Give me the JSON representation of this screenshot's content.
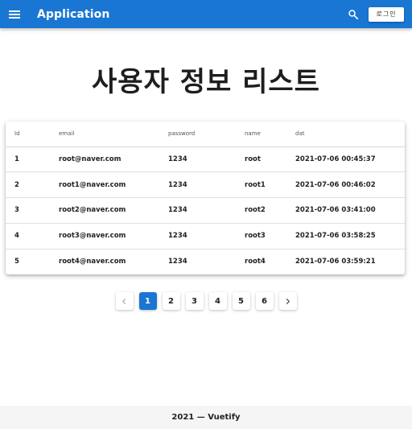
{
  "app_bar": {
    "title": "Application",
    "login_label": "로그인",
    "color": "#1976d2",
    "icons": [
      "menu-icon",
      "search-icon"
    ]
  },
  "main": {
    "title": "사용자 정보 리스트"
  },
  "table": {
    "columns": [
      "Id",
      "email",
      "password",
      "name",
      "dat"
    ],
    "rows": [
      [
        "1",
        "root@naver.com",
        "1234",
        "root",
        "2021-07-06 00:45:37"
      ],
      [
        "2",
        "root1@naver.com",
        "1234",
        "root1",
        "2021-07-06 00:46:02"
      ],
      [
        "3",
        "root2@naver.com",
        "1234",
        "root2",
        "2021-07-06 03:41:00"
      ],
      [
        "4",
        "root3@naver.com",
        "1234",
        "root3",
        "2021-07-06 03:58:25"
      ],
      [
        "5",
        "root4@naver.com",
        "1234",
        "root4",
        "2021-07-06 03:59:21"
      ]
    ]
  },
  "pagination": {
    "pages": [
      "1",
      "2",
      "3",
      "4",
      "5",
      "6"
    ],
    "current": "1",
    "icons": [
      "chevron-left-icon",
      "chevron-right-icon"
    ]
  },
  "footer": {
    "text": "2021 — Vuetify"
  }
}
